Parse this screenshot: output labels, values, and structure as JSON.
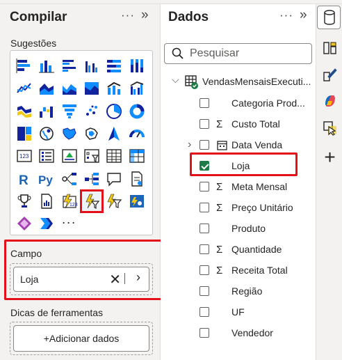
{
  "build_pane": {
    "title": "Compilar",
    "more_label": "···",
    "collapse_label": "»",
    "suggestions_label": "Sugestões",
    "more_visuals_label": "···",
    "field_section_label": "Campo",
    "field_value": "Loja",
    "tooltips_label": "Dicas de ferramentas",
    "add_data_label": "+Adicionar dados"
  },
  "data_pane": {
    "title": "Dados",
    "more_label": "···",
    "collapse_label": "»",
    "search_placeholder": "Pesquisar",
    "table_name": "VendasMensaisExecuti...",
    "fields": [
      {
        "label": "Categoria Prod...",
        "sigma": false,
        "checked": false,
        "expand": false
      },
      {
        "label": "Custo Total",
        "sigma": true,
        "checked": false,
        "expand": false
      },
      {
        "label": "Data Venda",
        "sigma": false,
        "checked": false,
        "expand": true,
        "calendar": true
      },
      {
        "label": "Loja",
        "sigma": false,
        "checked": true,
        "expand": false
      },
      {
        "label": "Meta Mensal",
        "sigma": true,
        "checked": false,
        "expand": false
      },
      {
        "label": "Preço Unitário",
        "sigma": true,
        "checked": false,
        "expand": false
      },
      {
        "label": "Produto",
        "sigma": false,
        "checked": false,
        "expand": false
      },
      {
        "label": "Quantidade",
        "sigma": true,
        "checked": false,
        "expand": false
      },
      {
        "label": "Receita Total",
        "sigma": true,
        "checked": false,
        "expand": false
      },
      {
        "label": "Região",
        "sigma": false,
        "checked": false,
        "expand": false
      },
      {
        "label": "UF",
        "sigma": false,
        "checked": false,
        "expand": false
      },
      {
        "label": "Vendedor",
        "sigma": false,
        "checked": false,
        "expand": false
      }
    ]
  },
  "colors": {
    "accent_blue": "#118dff",
    "highlight_red": "#e3101a",
    "check_green": "#1e7b46"
  }
}
